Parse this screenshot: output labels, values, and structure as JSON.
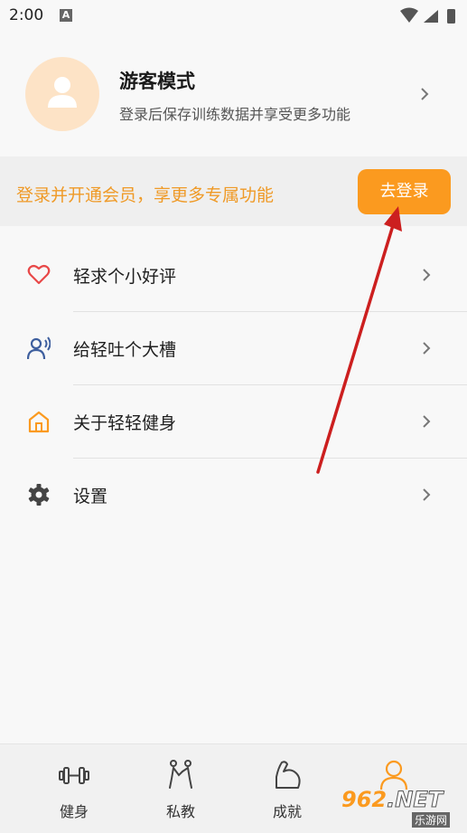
{
  "status_bar": {
    "time": "2:00",
    "a_icon": "A"
  },
  "profile": {
    "name": "游客模式",
    "subtitle": "登录后保存训练数据并享受更多功能"
  },
  "banner": {
    "text": "登录并开通会员，享更多专属功能",
    "button_label": "去登录"
  },
  "menu": [
    {
      "label": "轻求个小好评",
      "icon": "heart-icon"
    },
    {
      "label": "给轻吐个大槽",
      "icon": "feedback-icon"
    },
    {
      "label": "关于轻轻健身",
      "icon": "home-icon"
    },
    {
      "label": "设置",
      "icon": "gear-icon"
    }
  ],
  "tabs": [
    {
      "label": "健身",
      "icon": "dumbbell-icon"
    },
    {
      "label": "私教",
      "icon": "coach-icon"
    },
    {
      "label": "成就",
      "icon": "achievement-icon"
    },
    {
      "label": "",
      "icon": "profile-icon"
    }
  ],
  "watermark": {
    "main": "962",
    "net": ".NET",
    "sub": "乐游网"
  },
  "colors": {
    "accent": "#fb9a1f",
    "banner_text": "#ef9a27",
    "avatar_bg": "#fde3c6",
    "heart": "#e84848",
    "feedback": "#3e5f9e",
    "arrow": "#cc1f1f"
  }
}
